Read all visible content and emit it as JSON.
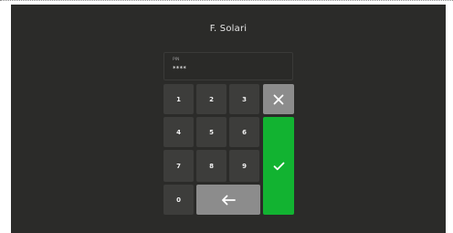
{
  "user": {
    "name": "F. Solari"
  },
  "pin": {
    "label": "PIN",
    "masked_value": "****"
  },
  "keypad": {
    "keys": [
      "1",
      "2",
      "3",
      "4",
      "5",
      "6",
      "7",
      "8",
      "9",
      "0"
    ],
    "clear_icon": "close-icon",
    "backspace_icon": "arrow-left-icon",
    "confirm_icon": "checkmark-icon"
  },
  "colors": {
    "screen_background": "#2b2b29",
    "key_background": "#3d3d3b",
    "action_key_background": "#8c8c8c",
    "confirm_background": "#12b331"
  }
}
